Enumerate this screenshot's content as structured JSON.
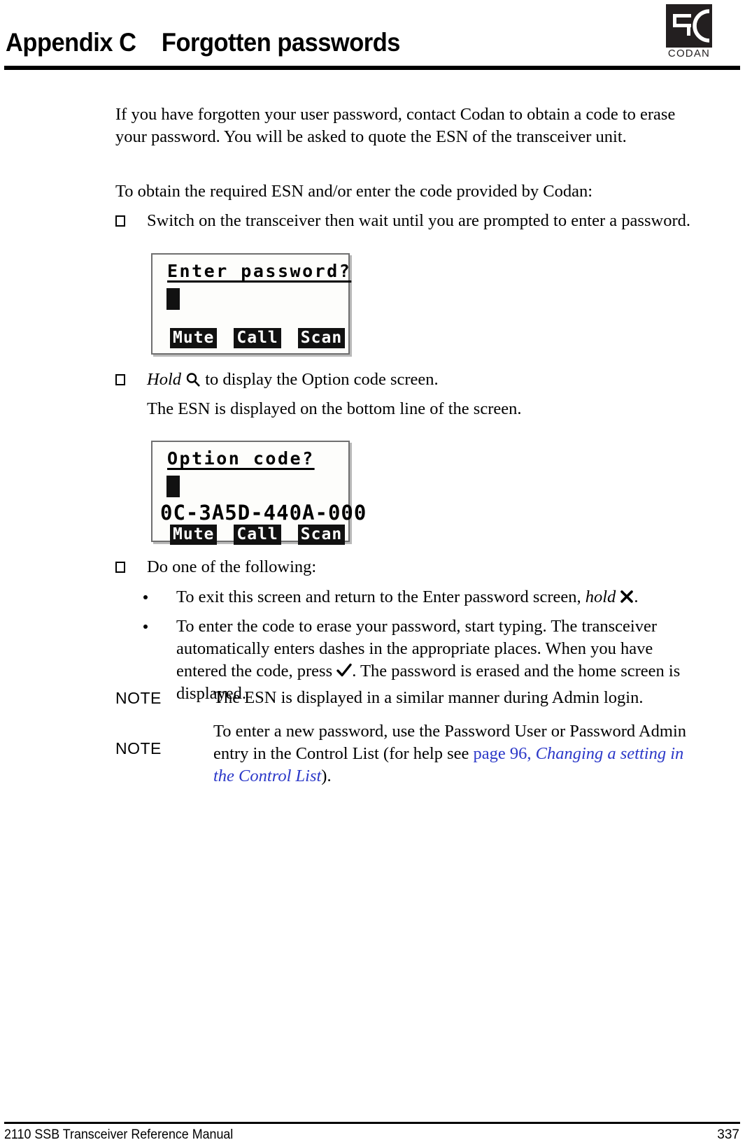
{
  "header": {
    "appendix_label": "Appendix C",
    "title": "Forgotten passwords",
    "logo_word": "CODAN"
  },
  "content": {
    "intro": "If you have forgotten your user password, contact Codan to obtain a code to erase your password. You will be asked to quote the ESN of the transceiver unit.",
    "lead": "To obtain the required ESN and/or enter the code provided by Codan:",
    "step1": "Switch on the transceiver then wait until you are prompted to enter a password.",
    "step2_prefix": "Hold",
    "step2_suffix": "to display the Option code screen.",
    "step2_note": "The ESN is displayed on the bottom line of the screen.",
    "step3": "Do one of the following:",
    "bullet1_prefix": "To exit this screen and return to the Enter password screen,",
    "bullet1_italic": "hold",
    "bullet1_suffix": ".",
    "bullet2_part1": "To enter the code to erase your password, start typing. The transceiver automatically enters dashes in the appropriate places. When you have entered the code, press",
    "bullet2_part2": ". The password is erased and the home screen is displayed."
  },
  "notes": [
    {
      "label": "NOTE",
      "text": "The ESN is displayed in a similar manner during Admin login."
    },
    {
      "label": "NOTE",
      "text_before": "To enter a new password, use the Password User or Password Admin entry in the Control List (for help see ",
      "link_page": "page 96",
      "link_sep": ", ",
      "link_title": "Changing a setting in the Control List",
      "text_after": ")."
    }
  ],
  "screens": [
    {
      "name": "enter-password-screen",
      "title": "Enter password?",
      "cursor": true,
      "esn": "",
      "softkeys": [
        "Mute",
        "Call",
        "Scan"
      ]
    },
    {
      "name": "option-code-screen",
      "title": "Option code?",
      "cursor": true,
      "esn": "0C-3A5D-440A-000",
      "softkeys": [
        "Mute",
        "Call",
        "Scan"
      ]
    }
  ],
  "icons": {
    "magnifier": "magnifier-icon",
    "cross": "cross-icon",
    "tick": "tick-icon"
  },
  "footer": {
    "manual": "2110 SSB Transceiver Reference Manual",
    "page": "337"
  },
  "colors": {
    "link": "#2b38c8",
    "logo": "#231f20",
    "lcd_bg": "#fdfdfb",
    "lcd_border": "#6f6f6f"
  }
}
